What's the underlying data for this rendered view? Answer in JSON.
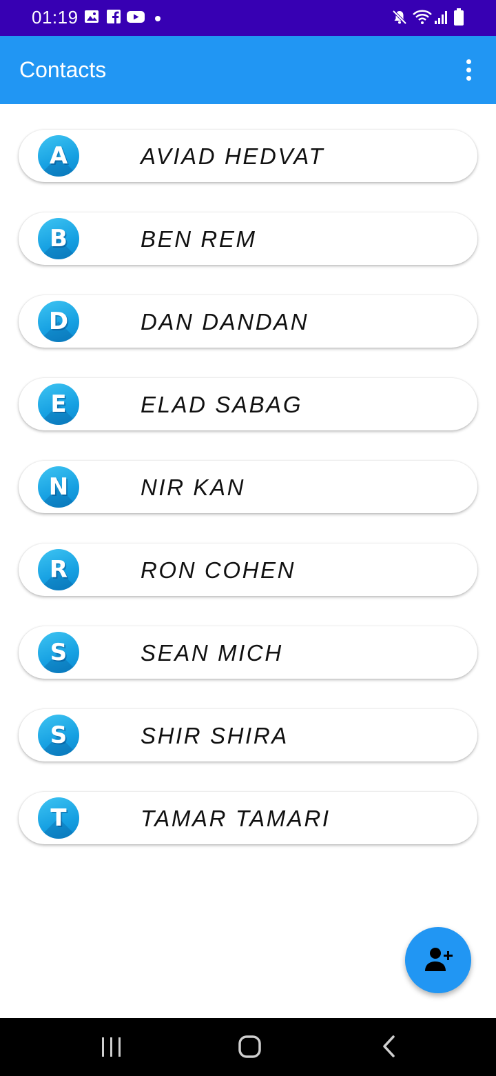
{
  "status_bar": {
    "time": "01:19",
    "notification_icons": [
      "gallery-icon",
      "facebook-icon",
      "youtube-icon",
      "dot-icon"
    ],
    "system_icons": [
      "mute-icon",
      "wifi-icon",
      "signal-icon",
      "battery-icon"
    ]
  },
  "app_bar": {
    "title": "Contacts",
    "menu_icon": "more-vert-icon"
  },
  "contacts": [
    {
      "initial": "A",
      "name": "AVIAD HEDVAT"
    },
    {
      "initial": "B",
      "name": "BEN REM"
    },
    {
      "initial": "D",
      "name": "DAN DANDAN"
    },
    {
      "initial": "E",
      "name": "ELAD SABAG"
    },
    {
      "initial": "N",
      "name": "NIR KAN"
    },
    {
      "initial": "R",
      "name": "RON COHEN"
    },
    {
      "initial": "S",
      "name": "SEAN MICH"
    },
    {
      "initial": "S",
      "name": "SHIR SHIRA"
    },
    {
      "initial": "T",
      "name": "TAMAR TAMARI"
    }
  ],
  "fab": {
    "icon": "add-person-icon"
  },
  "nav_bar": {
    "icons": [
      "recents-icon",
      "home-icon",
      "back-icon"
    ]
  },
  "colors": {
    "status_bar": "#3700b3",
    "app_bar": "#2196f3",
    "avatar": "#16a0e2",
    "fab": "#2196f3",
    "nav_bar": "#000000"
  }
}
